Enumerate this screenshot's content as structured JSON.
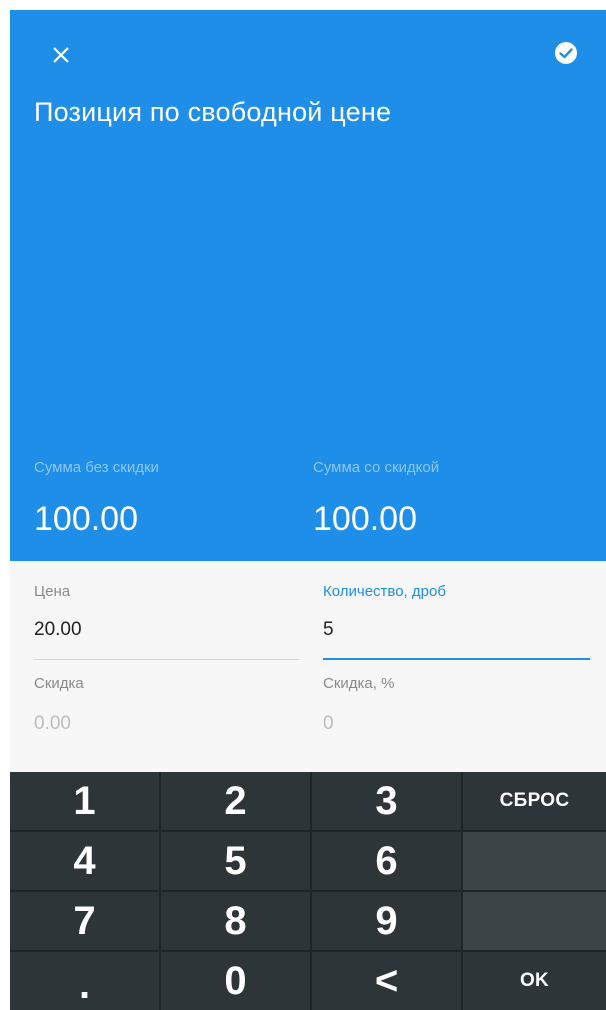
{
  "header": {
    "title": "Позиция по свободной цене",
    "close_icon": "close-icon",
    "confirm_icon": "check-circle-icon",
    "sum_without_discount_label": "Сумма без скидки",
    "sum_without_discount_value": "100.00",
    "sum_with_discount_label": "Сумма со скидкой",
    "sum_with_discount_value": "100.00"
  },
  "form": {
    "price_label": "Цена",
    "price_value": "20.00",
    "quantity_label": "Количество, дроб",
    "quantity_value": "5",
    "discount_label": "Скидка",
    "discount_placeholder": "0.00",
    "discount_percent_label": "Скидка, %",
    "discount_percent_placeholder": "0"
  },
  "keypad": {
    "k1": "1",
    "k2": "2",
    "k3": "3",
    "reset": "СБРОС",
    "k4": "4",
    "k5": "5",
    "k6": "6",
    "k7": "7",
    "k8": "8",
    "k9": "9",
    "dot": ".",
    "k0": "0",
    "backspace": "<",
    "ok": "OK"
  },
  "colors": {
    "accent": "#1e8ee9",
    "keypad_bg": "#2d3538",
    "keypad_blank": "#3b4447"
  }
}
